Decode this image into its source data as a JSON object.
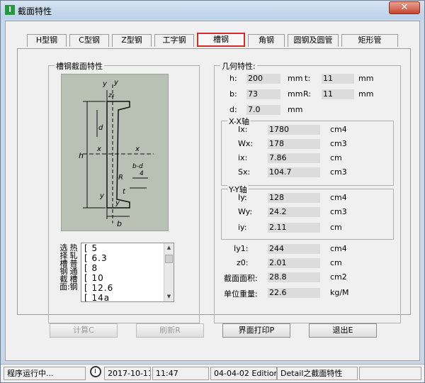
{
  "window": {
    "title": "截面特性",
    "close_symbol": "✕"
  },
  "tabs": [
    {
      "label": "H型钢"
    },
    {
      "label": "C型钢"
    },
    {
      "label": "Z型钢"
    },
    {
      "label": "工字钢"
    },
    {
      "label": "槽钢",
      "active": true
    },
    {
      "label": "角钢"
    },
    {
      "label": "圆钢及圆管"
    },
    {
      "label": "矩形管"
    }
  ],
  "section_group": {
    "title": "槽钢截面特性"
  },
  "geometry": {
    "title": "几何特性:",
    "h_label": "h:",
    "h_value": "200",
    "h_unit": "mm",
    "t_label": "t:",
    "t_value": "11",
    "t_unit": "mm",
    "b_label": "b:",
    "b_value": "73",
    "b_unit": "mm",
    "R_label": "R:",
    "R_value": "11",
    "R_unit": "mm",
    "d_label": "d:",
    "d_value": "7.0",
    "d_unit": "mm"
  },
  "xx_axis": {
    "title": "X-X轴",
    "Ix_label": "Ix:",
    "Ix_value": "1780",
    "Ix_unit": "cm4",
    "Wx_label": "Wx:",
    "Wx_value": "178",
    "Wx_unit": "cm3",
    "ix_label": "ix:",
    "ix_value": "7.86",
    "ix_unit": "cm",
    "Sx_label": "Sx:",
    "Sx_value": "104.7",
    "Sx_unit": "cm3"
  },
  "yy_axis": {
    "title": "Y-Y轴",
    "Iy_label": "Iy:",
    "Iy_value": "128",
    "Iy_unit": "cm4",
    "Wy_label": "Wy:",
    "Wy_value": "24.2",
    "Wy_unit": "cm3",
    "iy_label": "iy:",
    "iy_value": "2.11",
    "iy_unit": "cm"
  },
  "other": {
    "Iy1_label": "Iy1:",
    "Iy1_value": "244",
    "Iy1_unit": "cm4",
    "z0_label": "z0:",
    "z0_value": "2.01",
    "z0_unit": "cm",
    "area_label": "截面面积:",
    "area_value": "28.8",
    "area_unit": "cm2",
    "weight_label": "单位重量:",
    "weight_value": "22.6",
    "weight_unit": "kg/M"
  },
  "diagram_labels": {
    "y_top1": "y",
    "y_top2": "y",
    "z0": "z₀",
    "x_left": "x",
    "x_right": "x",
    "d": "d",
    "h": "h",
    "t": "t",
    "R": "R",
    "bd": "b-d",
    "four": "4",
    "y_bot1": "y",
    "y_bot2": "y",
    "b": "b",
    "y1": "1",
    "y1b": "1"
  },
  "selector": {
    "label_col1": "选择槽钢截面:",
    "label_col2": "热轧普通槽钢",
    "items": [
      "[ 5",
      "[ 6.3",
      "[ 8",
      "[ 10",
      "[ 12.6",
      "[ 14a"
    ],
    "scroll_up": "▲",
    "scroll_down": "▼"
  },
  "buttons": {
    "calc": "计算C",
    "refresh": "刷新R",
    "print": "界面打印P",
    "exit": "退出E"
  },
  "status": {
    "message": "程序运行中...",
    "date": "2017-10-11",
    "time": "11:47",
    "version": "04-04-02 Edition",
    "module": "Detail之截面特性"
  },
  "colors": {
    "active_tab_border": "#d42b2b",
    "diagram_bg": "#b9c0b4"
  }
}
